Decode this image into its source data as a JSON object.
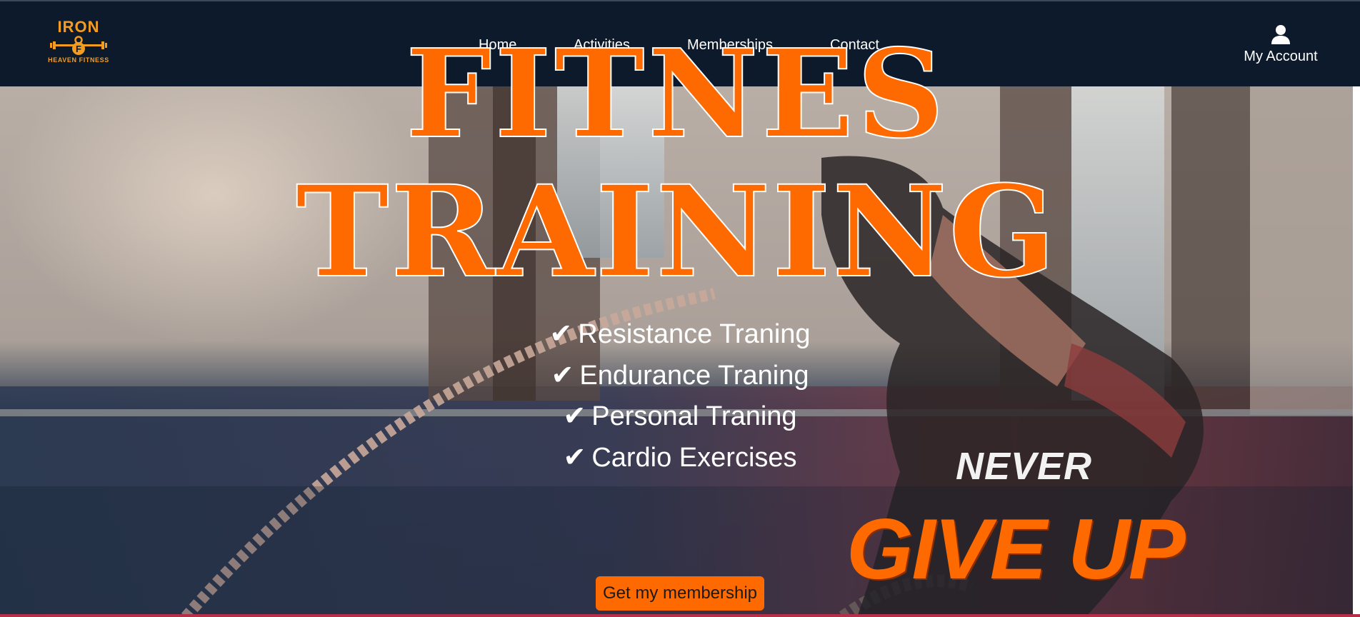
{
  "header": {
    "logo": {
      "top_text": "IRON",
      "mark_letter": "F",
      "sub_text": "HEAVEN FITNESS",
      "color": "#f39c1f"
    },
    "nav": [
      {
        "label": "Home"
      },
      {
        "label": "Activities"
      },
      {
        "label": "Memberships"
      },
      {
        "label": "Contact"
      }
    ],
    "account": {
      "label": "My Account",
      "icon": "user-icon"
    }
  },
  "hero": {
    "title_line1": "FITNES",
    "title_line2": "TRAINING",
    "features": [
      {
        "icon": "double-check-icon",
        "text": "Resistance Traning"
      },
      {
        "icon": "double-check-icon",
        "text": "Endurance Traning"
      },
      {
        "icon": "double-check-icon",
        "text": "Personal Traning"
      },
      {
        "icon": "double-check-icon",
        "text": "Cardio Exercises"
      }
    ],
    "cta_label": "Get my membership",
    "motto_line1": "NEVER",
    "motto_line2": "GIVE UP"
  },
  "colors": {
    "accent": "#ff6a00",
    "header_bg": "#0c1a2b",
    "text_light": "#ffffff"
  }
}
